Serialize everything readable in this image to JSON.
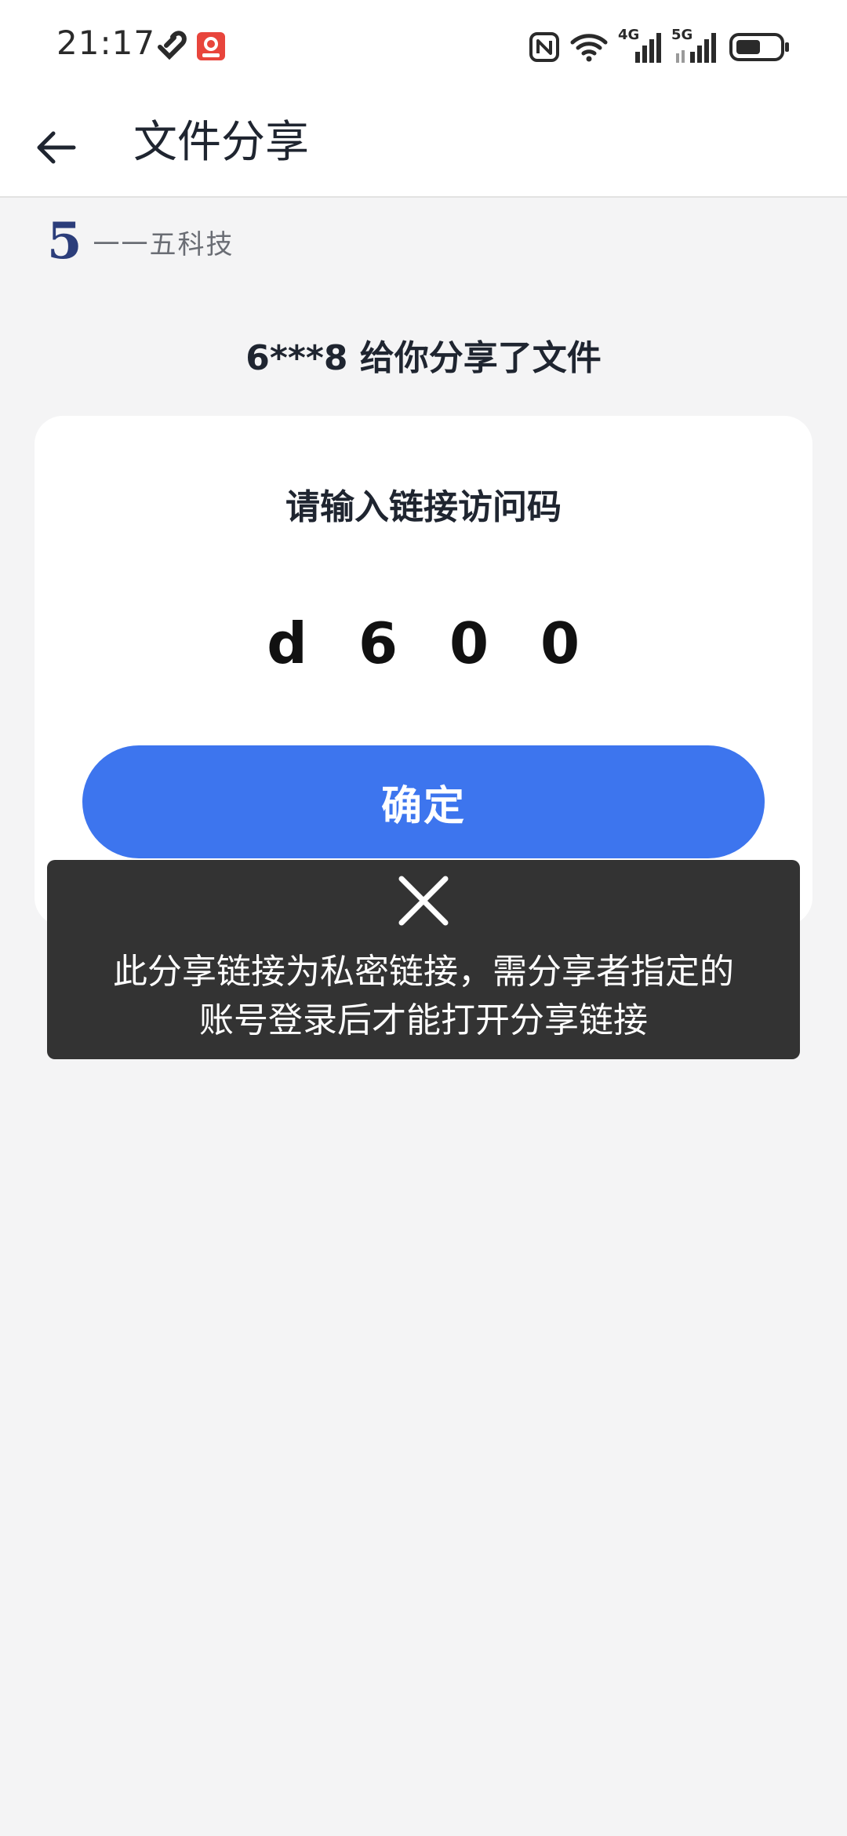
{
  "status_bar": {
    "time": "21:17",
    "icons": [
      "heart-link-icon",
      "app-badge-icon",
      "nfc-icon",
      "wifi-icon",
      "signal-4g-icon",
      "signal-5g-icon",
      "battery-icon"
    ],
    "signal_4g_label": "4G",
    "signal_5g_label": "5G"
  },
  "app_bar": {
    "back_icon": "arrow-left-icon",
    "title": "文件分享"
  },
  "brand": {
    "logo_text": "5",
    "name": "一一五科技",
    "logo_color": "#2b3d7a"
  },
  "share": {
    "title": "6***8 给你分享了文件"
  },
  "card": {
    "label": "请输入链接访问码",
    "code": [
      "d",
      "6",
      "0",
      "0"
    ],
    "confirm_label": "确定",
    "accent_color": "#3d75ee"
  },
  "toast": {
    "icon": "close-icon",
    "message_line1": "此分享链接为私密链接，需分享者指定的",
    "message_line2": "账号登录后才能打开分享链接"
  }
}
